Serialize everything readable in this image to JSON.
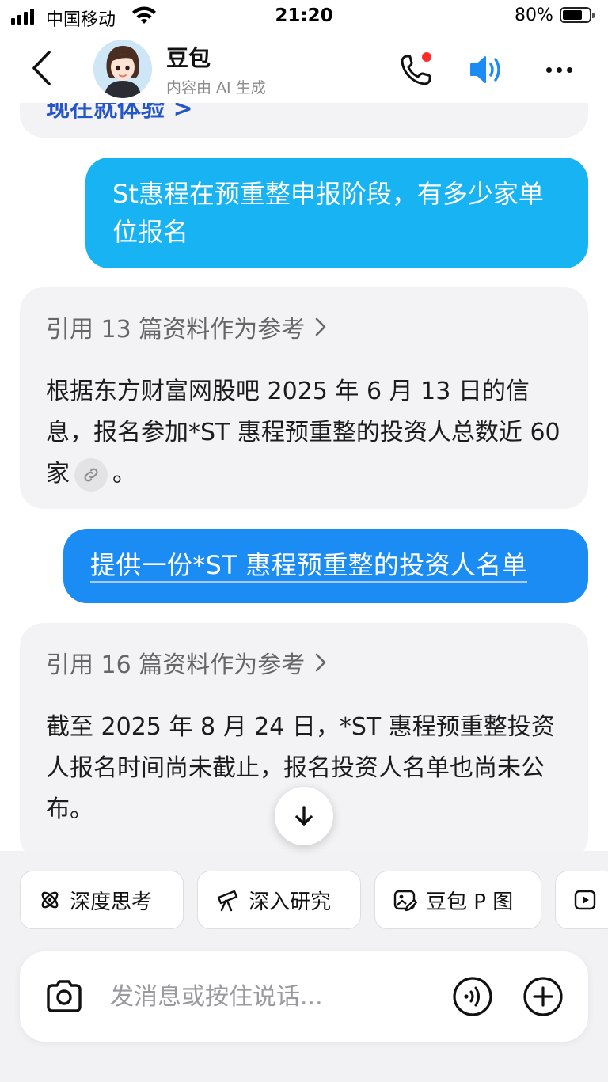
{
  "status_bar": {
    "carrier": "中国移动",
    "time": "21:20",
    "battery": "80%",
    "battery_level": 0.8
  },
  "header": {
    "name": "豆包",
    "subtitle": "内容由 AI 生成",
    "icons": [
      "back-icon",
      "avatar",
      "phone-icon",
      "speaker-icon",
      "more-icon"
    ],
    "accent_color": "#1a8cf4",
    "notification_dot_color": "#ff2a2a"
  },
  "messages": {
    "prev_bot_text": "现在就体验 >",
    "user_1": "St惠程在预重整申报阶段，有多少家单位报名",
    "bot_1": {
      "citation": "引用 13 篇资料作为参考",
      "text": "根据东方财富网股吧 2025 年 6 月 13 日的信息，报名参加*ST 惠程预重整的投资人总数近 60 家",
      "end": "。"
    },
    "user_2": "提供一份*ST 惠程预重整的投资人名单",
    "bot_2": {
      "citation": "引用 16 篇资料作为参考",
      "text": "截至 2025 年 8 月 24 日，*ST 惠程预重整投资人报名时间尚未截止，报名投资人名单也尚未公布。"
    }
  },
  "chips": [
    {
      "label": "深度思考",
      "icon": "atom-icon"
    },
    {
      "label": "深入研究",
      "icon": "telescope-icon"
    },
    {
      "label": "豆包 P 图",
      "icon": "image-edit-icon"
    },
    {
      "label": "",
      "icon": "video-icon"
    }
  ],
  "input": {
    "placeholder": "发消息或按住说话..."
  },
  "colors": {
    "user_bubble_1": "#18b3f3",
    "user_bubble_2": "#1a8cf4",
    "bot_bubble": "#f3f3f5",
    "panel": "#f2f2f4"
  }
}
